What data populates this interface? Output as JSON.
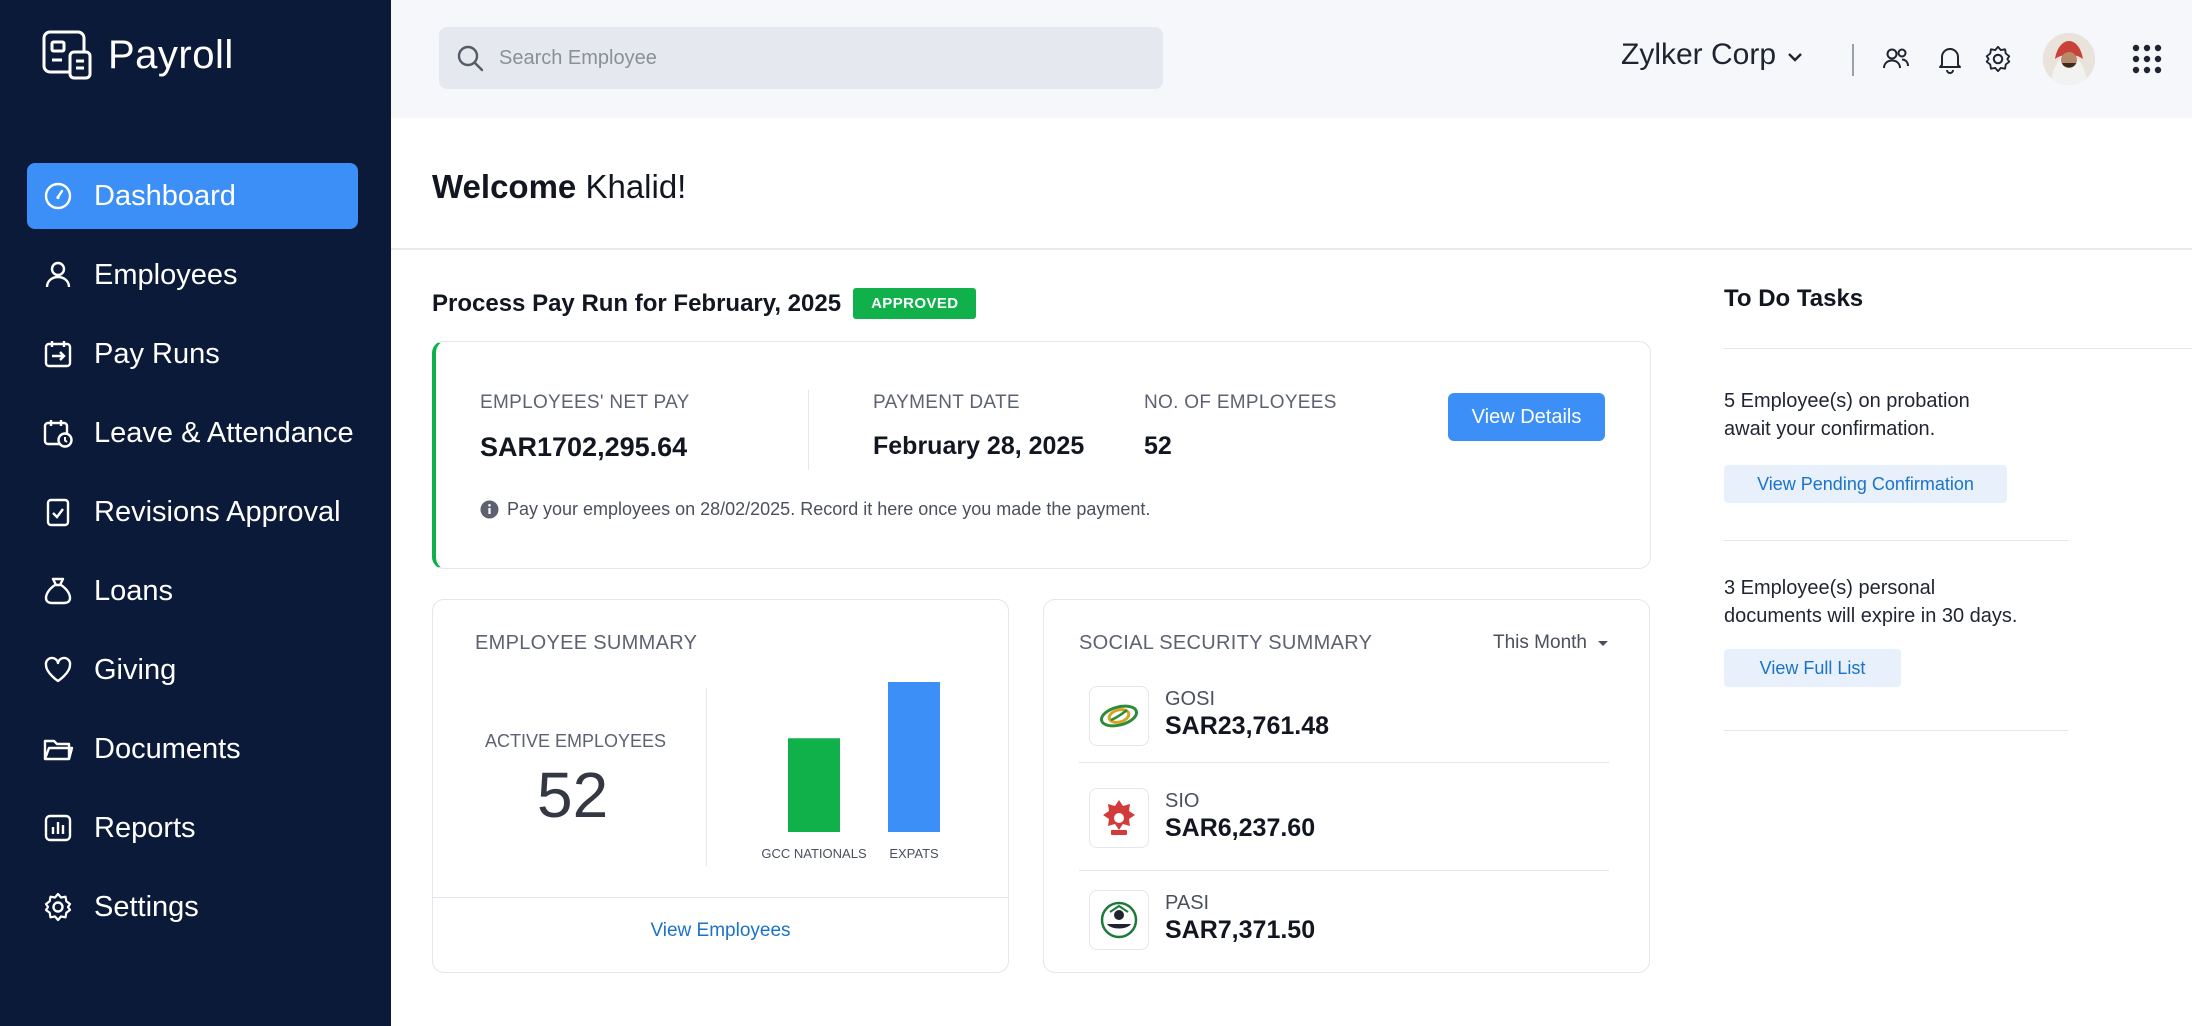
{
  "app": {
    "name": "Payroll"
  },
  "sidebar": {
    "items": [
      {
        "label": "Dashboard",
        "icon": "dashboard-icon"
      },
      {
        "label": "Employees",
        "icon": "person-icon"
      },
      {
        "label": "Pay Runs",
        "icon": "payrun-icon"
      },
      {
        "label": "Leave & Attendance",
        "icon": "calendar-clock-icon"
      },
      {
        "label": "Revisions Approval",
        "icon": "checklist-icon"
      },
      {
        "label": "Loans",
        "icon": "money-bag-icon"
      },
      {
        "label": "Giving",
        "icon": "heart-icon"
      },
      {
        "label": "Documents",
        "icon": "folder-icon"
      },
      {
        "label": "Reports",
        "icon": "bar-chart-icon"
      },
      {
        "label": "Settings",
        "icon": "gear-icon"
      }
    ],
    "active_index": 0
  },
  "header": {
    "search_placeholder": "Search Employee",
    "org_name": "Zylker Corp"
  },
  "welcome": {
    "prefix": "Welcome",
    "name": "Khalid!"
  },
  "payrun": {
    "title": "Process Pay Run for February, 2025",
    "status": "APPROVED",
    "net_pay_label": "EMPLOYEES' NET PAY",
    "net_pay_value": "SAR1702,295.64",
    "payment_date_label": "PAYMENT DATE",
    "payment_date_value": "February 28, 2025",
    "employees_label": "NO. OF EMPLOYEES",
    "employees_value": "52",
    "button": "View Details",
    "note": "Pay your employees on 28/02/2025. Record it here once you made the payment."
  },
  "employee_summary": {
    "title": "EMPLOYEE SUMMARY",
    "active_label": "ACTIVE EMPLOYEES",
    "active_count": "52",
    "link": "View Employees"
  },
  "chart_data": {
    "type": "bar",
    "categories": [
      "GCC NATIONALS",
      "EXPATS"
    ],
    "values": [
      20,
      32
    ],
    "colors": [
      "#10b04a",
      "#3b8ff6"
    ]
  },
  "social_security": {
    "title": "SOCIAL SECURITY SUMMARY",
    "period": "This Month",
    "rows": [
      {
        "name": "GOSI",
        "amount": "SAR23,761.48"
      },
      {
        "name": "SIO",
        "amount": "SAR6,237.60"
      },
      {
        "name": "PASI",
        "amount": "SAR7,371.50"
      }
    ]
  },
  "todo": {
    "title": "To Do Tasks",
    "tasks": [
      {
        "line1": "5 Employee(s) on probation",
        "line2": "await your confirmation.",
        "button": "View Pending Confirmation"
      },
      {
        "line1": "3 Employee(s) personal",
        "line2": "documents will expire in 30 days.",
        "button": "View Full List"
      }
    ]
  }
}
